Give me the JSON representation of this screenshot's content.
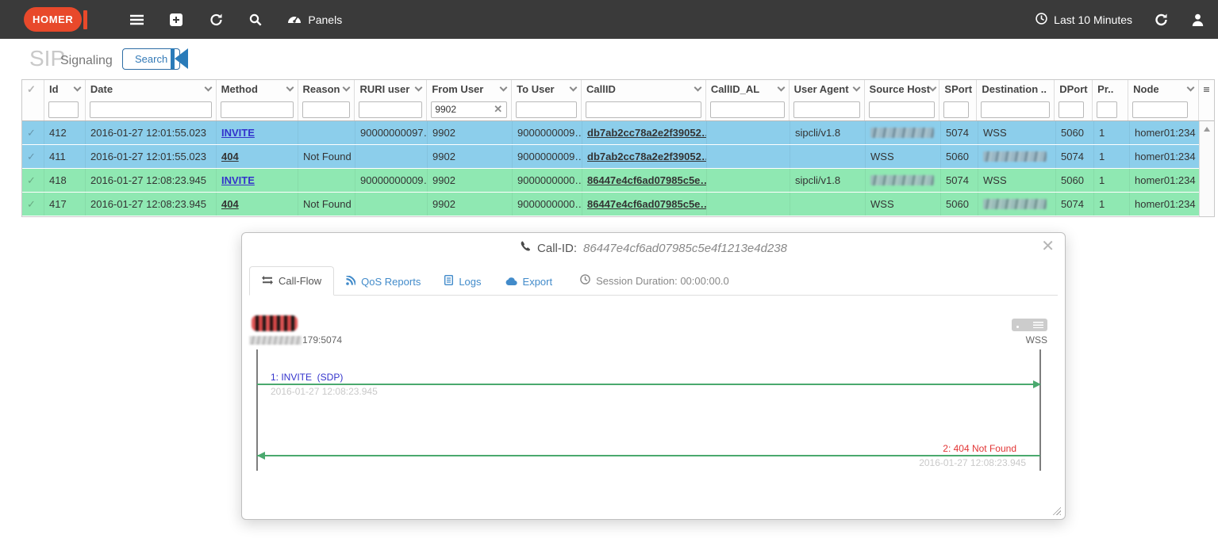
{
  "navbar": {
    "brand": "HOMER",
    "panels_label": "Panels",
    "time_range": "Last 10 Minutes"
  },
  "page_header": {
    "title": "SIP",
    "subtitle": "Signaling",
    "search_button": "Search"
  },
  "table": {
    "columns": [
      {
        "label": ""
      },
      {
        "label": "Id"
      },
      {
        "label": "Date"
      },
      {
        "label": "Method"
      },
      {
        "label": "Reason"
      },
      {
        "label": "RURI user"
      },
      {
        "label": "From User"
      },
      {
        "label": "To User"
      },
      {
        "label": "CallID"
      },
      {
        "label": "CallID_AL"
      },
      {
        "label": "User Agent"
      },
      {
        "label": "Source Host"
      },
      {
        "label": "SPort"
      },
      {
        "label": "Destination .."
      },
      {
        "label": "DPort"
      },
      {
        "label": "Pr.."
      },
      {
        "label": "Node"
      }
    ],
    "filters": {
      "from_user": "9902"
    },
    "rows": [
      {
        "id": "412",
        "date": "2016-01-27 12:01:55.023",
        "method": "INVITE",
        "reason": "",
        "ruri_user": "90000000097…",
        "from_user": "9902",
        "to_user": "9000000009…",
        "callid": "db7ab2cc78a2e2f39052…",
        "callid_al": "",
        "user_agent": "sipcli/v1.8",
        "source_host": "[redacted]",
        "sport": "5074",
        "destination": "WSS",
        "dport": "5060",
        "proto": "1",
        "node": "homer01:234"
      },
      {
        "id": "411",
        "date": "2016-01-27 12:01:55.023",
        "method": "404",
        "reason": "Not Found",
        "ruri_user": "",
        "from_user": "9902",
        "to_user": "9000000009…",
        "callid": "db7ab2cc78a2e2f39052…",
        "callid_al": "",
        "user_agent": "",
        "source_host": "WSS",
        "sport": "5060",
        "destination": "[redacted]",
        "dport": "5074",
        "proto": "1",
        "node": "homer01:234"
      },
      {
        "id": "418",
        "date": "2016-01-27 12:08:23.945",
        "method": "INVITE",
        "reason": "",
        "ruri_user": "90000000009…",
        "from_user": "9902",
        "to_user": "9000000000…",
        "callid": "86447e4cf6ad07985c5e…",
        "callid_al": "",
        "user_agent": "sipcli/v1.8",
        "source_host": "[redacted]",
        "sport": "5074",
        "destination": "WSS",
        "dport": "5060",
        "proto": "1",
        "node": "homer01:234"
      },
      {
        "id": "417",
        "date": "2016-01-27 12:08:23.945",
        "method": "404",
        "reason": "Not Found",
        "ruri_user": "",
        "from_user": "9902",
        "to_user": "9000000000…",
        "callid": "86447e4cf6ad07985c5e…",
        "callid_al": "",
        "user_agent": "",
        "source_host": "WSS",
        "sport": "5060",
        "destination": "[redacted]",
        "dport": "5074",
        "proto": "1",
        "node": "homer01:234"
      }
    ]
  },
  "modal": {
    "title_label": "Call-ID:",
    "call_id": "86447e4cf6ad07985c5e4f1213e4d238",
    "tabs": {
      "call_flow": "Call-Flow",
      "qos": "QoS Reports",
      "logs": "Logs",
      "export": "Export"
    },
    "session_duration": "Session Duration: 00:00:00.0",
    "flow": {
      "left_endpoint_label": "179:5074",
      "right_endpoint_label": "WSS",
      "messages": [
        {
          "label": "1: INVITE  (SDP)",
          "timestamp": "2016-01-27 12:08:23.945"
        },
        {
          "label": "2: 404 Not Found",
          "timestamp": "2016-01-27 12:08:23.945"
        }
      ]
    }
  },
  "colors": {
    "navbar_bg": "#3a3a3a",
    "brand_orange": "#e8492b",
    "row_blue": "#8cceeb",
    "row_green": "#8fe8b2",
    "link_blue": "#428bca",
    "method_blue": "#3333cc",
    "error_red": "#e23434",
    "arrow_green": "#4aa96e"
  }
}
